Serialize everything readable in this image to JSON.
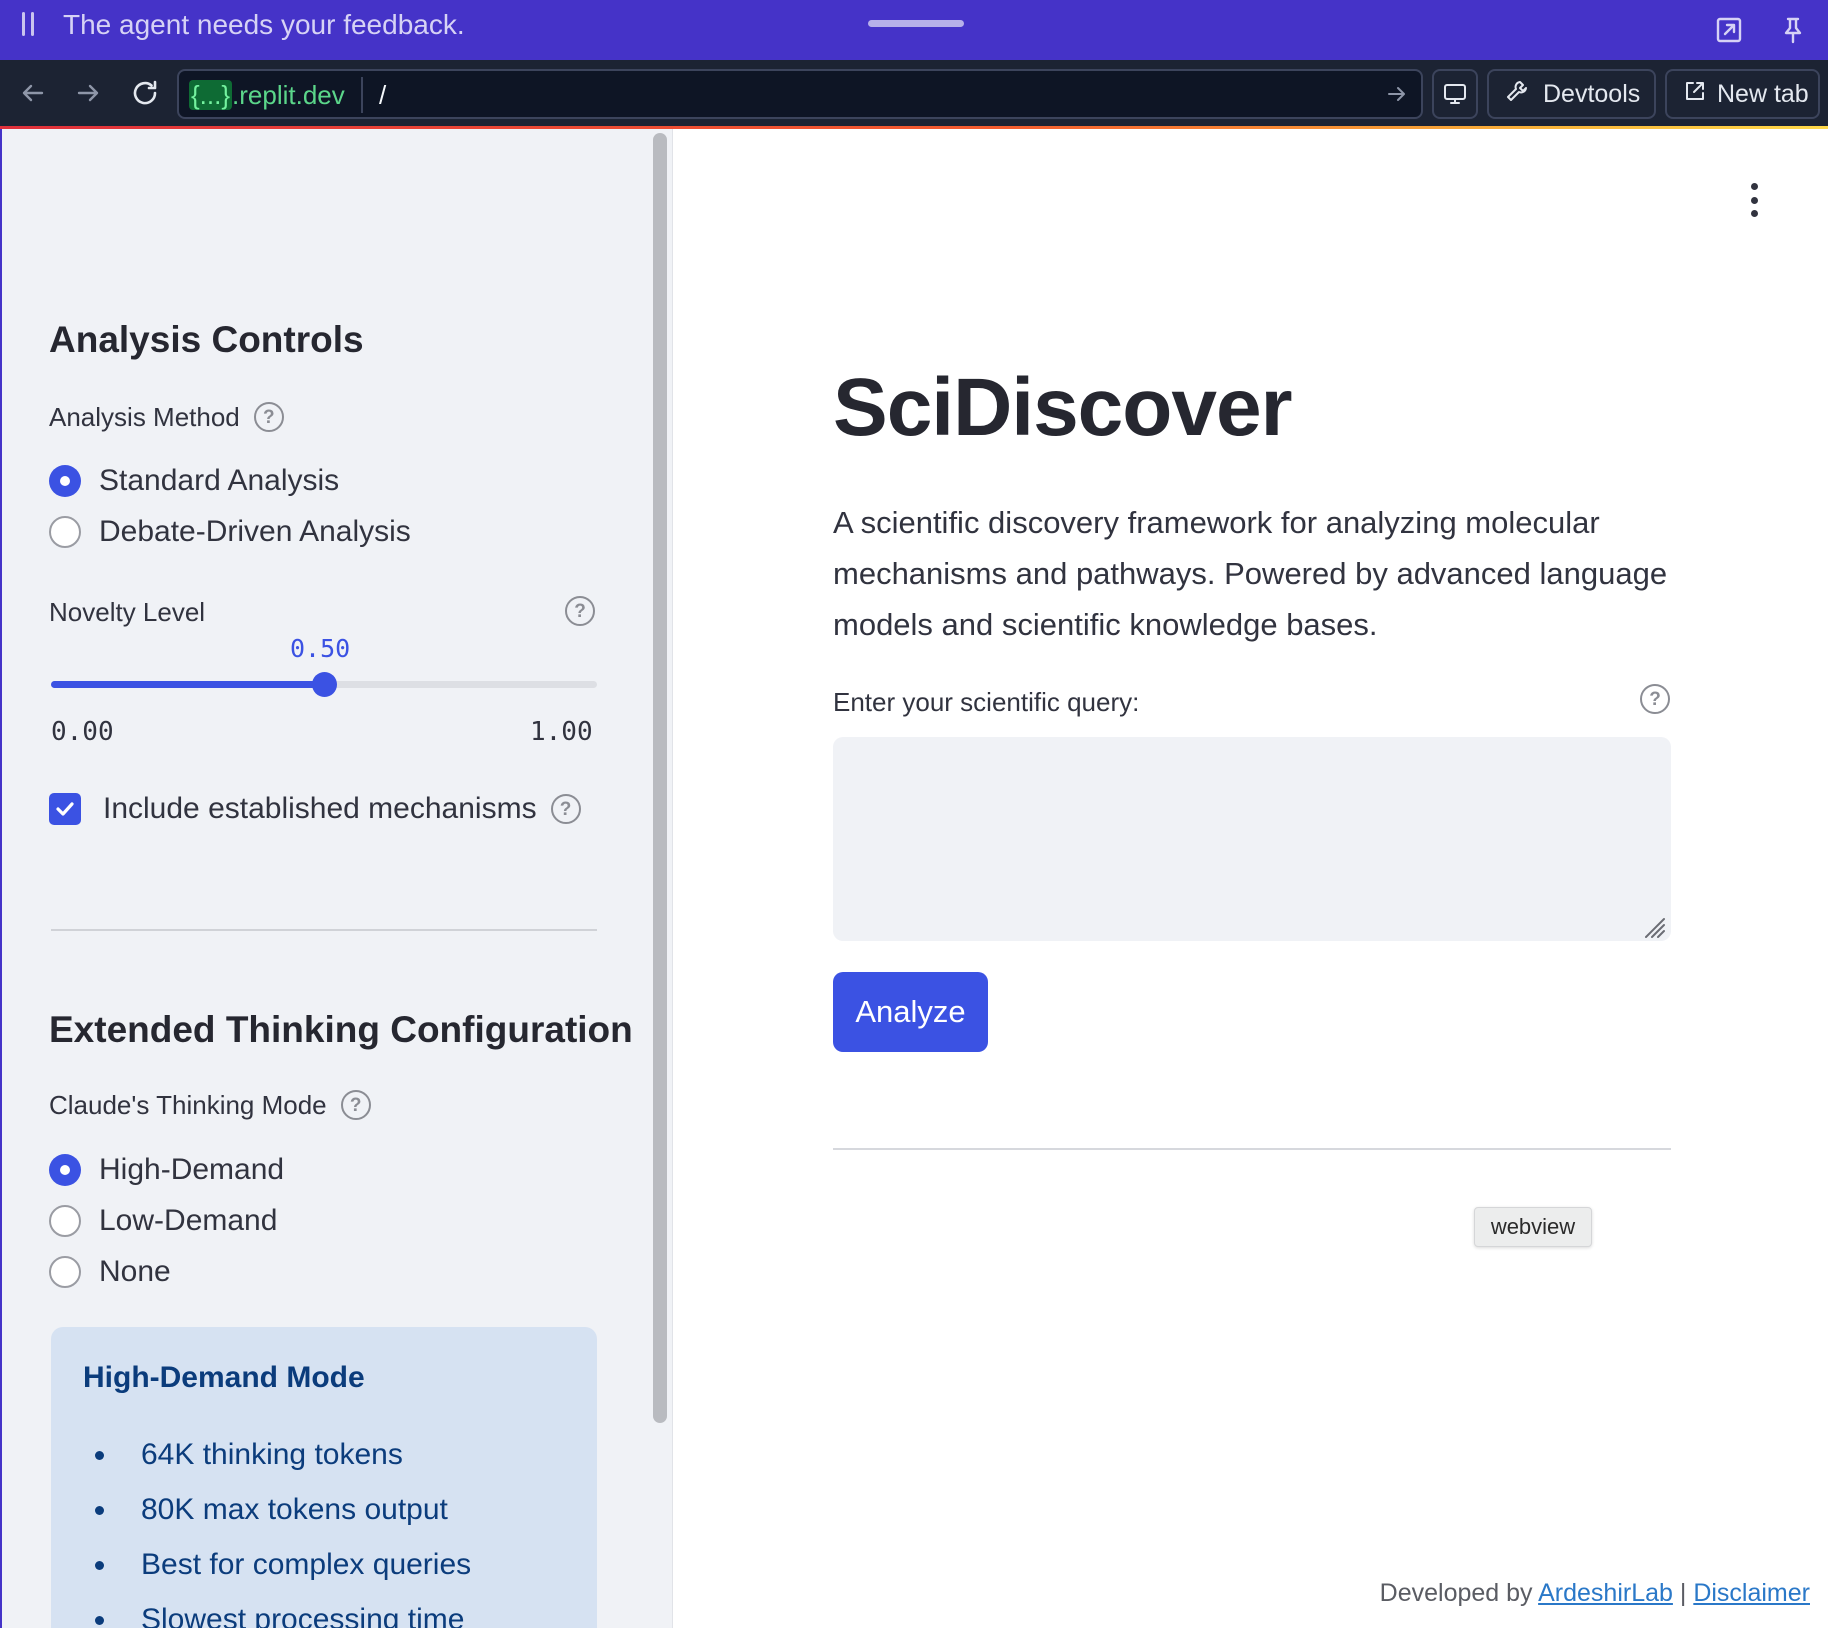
{
  "agent_bar": {
    "title": "The agent needs your feedback."
  },
  "browser": {
    "url_tag": "{...}",
    "url_domain": ".replit.dev",
    "url_path": "/",
    "devtools_label": "Devtools",
    "new_tab_label": "New tab"
  },
  "sidebar": {
    "analysis_heading": "Analysis Controls",
    "method_label": "Analysis Method",
    "method_options": [
      {
        "label": "Standard Analysis",
        "selected": true
      },
      {
        "label": "Debate-Driven Analysis",
        "selected": false
      }
    ],
    "novelty_label": "Novelty Level",
    "novelty_value": "0.50",
    "novelty_fraction": 0.5,
    "novelty_min": "0.00",
    "novelty_max": "1.00",
    "include_label": "Include established mechanisms",
    "include_checked": true,
    "thinking_heading": "Extended Thinking Configuration",
    "thinking_label": "Claude's Thinking Mode",
    "thinking_options": [
      {
        "label": "High-Demand",
        "selected": true
      },
      {
        "label": "Low-Demand",
        "selected": false
      },
      {
        "label": "None",
        "selected": false
      }
    ],
    "info_box": {
      "title": "High-Demand Mode",
      "items": [
        "64K thinking tokens",
        "80K max tokens output",
        "Best for complex queries",
        "Slowest processing time"
      ]
    }
  },
  "main": {
    "title": "SciDiscover",
    "description": "A scientific discovery framework for analyzing molecular mechanisms and pathways. Powered by advanced language models and scientific knowledge bases.",
    "query_label": "Enter your scientific query:",
    "query_value": "",
    "analyze_label": "Analyze",
    "tooltip": "webview",
    "footer": {
      "prefix": "Developed by ",
      "link1": "ArdeshirLab",
      "separator": " | ",
      "link2": "Disclaimer"
    }
  },
  "colors": {
    "accent": "#3b52e3",
    "agent_bar": "#4533c8",
    "browser_bar": "#1c2333",
    "sidebar_bg": "#f0f2f6",
    "info_bg": "#d6e2f2",
    "info_text": "#0b3c7c"
  },
  "icons": {
    "agent_grip": "pause-grip-icon",
    "agent_actions": [
      "expand-arrow-icon",
      "pin-icon"
    ],
    "nav": [
      "back-arrow-icon",
      "forward-arrow-icon",
      "reload-icon"
    ],
    "url_go": "go-arrow-icon",
    "devices": "monitor-icon",
    "devtools": "wrench-icon",
    "new_tab": "external-link-icon",
    "menu": "kebab-menu-icon",
    "help": "question-circle-icon"
  }
}
